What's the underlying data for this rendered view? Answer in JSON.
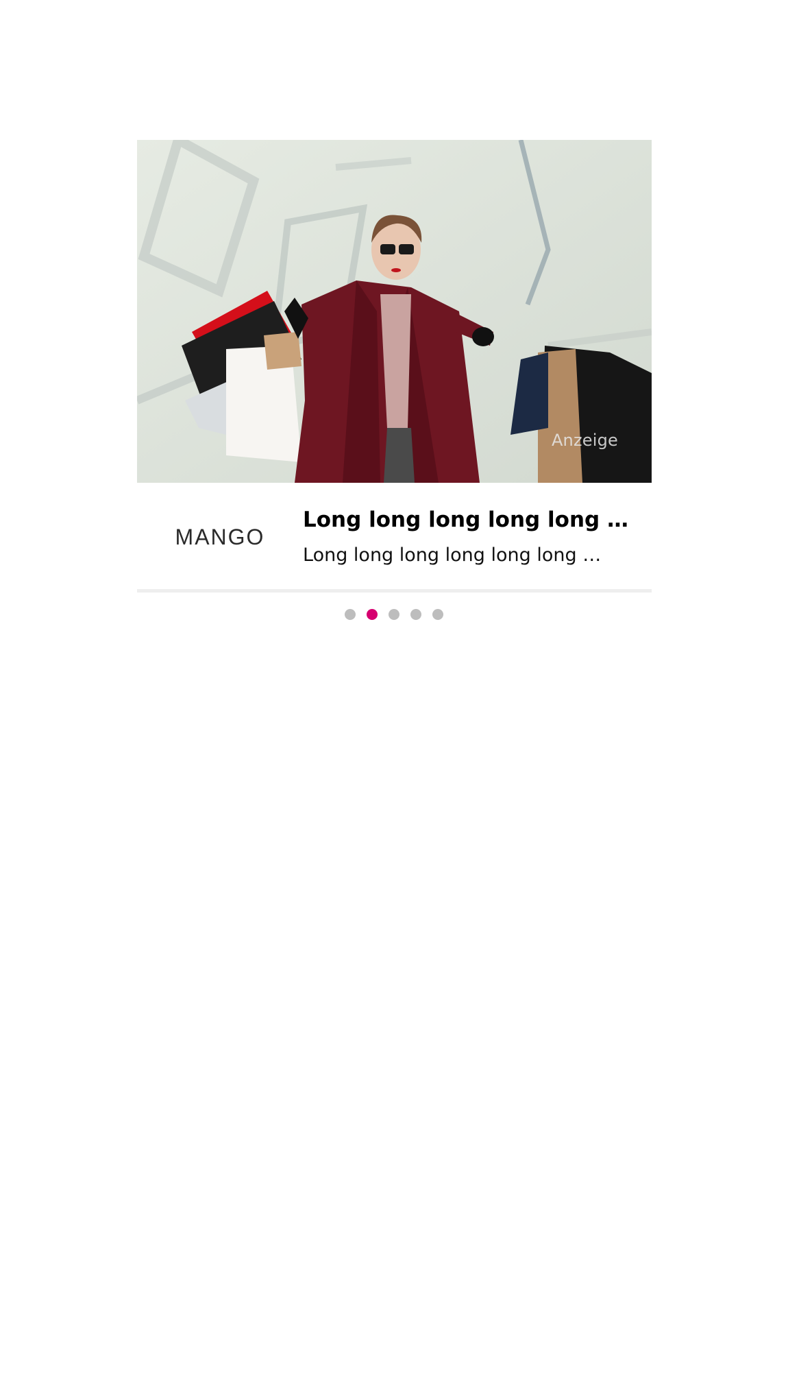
{
  "ad": {
    "label": "Anzeige",
    "brand_logo_text": "MANGO",
    "title": "Long long long long long long long long title",
    "subtitle": "Long long long long long long long long long subtitle",
    "image_icon": "shopping-woman-photo"
  },
  "carousel": {
    "total": 5,
    "active_index": 1,
    "active_color": "#d6006f",
    "inactive_color": "#bdbdbd"
  }
}
